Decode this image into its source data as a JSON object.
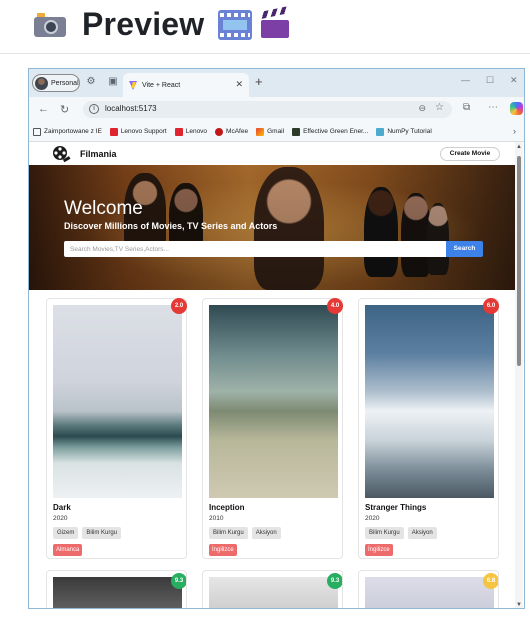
{
  "document": {
    "title": "Preview"
  },
  "browser": {
    "profile_label": "Personal",
    "tab_title": "Vite + React",
    "url": "localhost:5173",
    "bookmarks": [
      "Zaimportowane z IE",
      "Lenovo Support",
      "Lenovo",
      "McAfee",
      "Gmail",
      "Effective Green Ener...",
      "NumPy Tutorial"
    ]
  },
  "app": {
    "brand": "Filmania",
    "create_button": "Create Movie",
    "hero": {
      "title": "Welcome",
      "subtitle": "Discover Millions of Movies, TV Series and Actors",
      "search_placeholder": "Search Movies,TV Series,Actors...",
      "search_button": "Search"
    },
    "movies": [
      {
        "title": "Dark",
        "year": "2020",
        "rating": "2.0",
        "rating_color": "#e53935",
        "tags": [
          "Gizem",
          "Bilim Kurgu"
        ],
        "language": "Almanca"
      },
      {
        "title": "Inception",
        "year": "2010",
        "rating": "4.0",
        "rating_color": "#e53935",
        "tags": [
          "Bilim Kurgu",
          "Aksiyon"
        ],
        "language": "İngilizce"
      },
      {
        "title": "Stranger Things",
        "year": "2020",
        "rating": "6.0",
        "rating_color": "#e53935",
        "tags": [
          "Bilim Kurgu",
          "Aksiyon"
        ],
        "language": "İngilizce"
      }
    ],
    "next_row_ratings": [
      {
        "rating": "9.3",
        "rating_color": "#27ae60"
      },
      {
        "rating": "9.3",
        "rating_color": "#27ae60"
      },
      {
        "rating": "6.8",
        "rating_color": "#f5c542"
      }
    ]
  },
  "colors": {
    "accent": "#3d82e8",
    "language_badge": "#ee6b6b",
    "tag_bg": "#e4e4e4"
  }
}
